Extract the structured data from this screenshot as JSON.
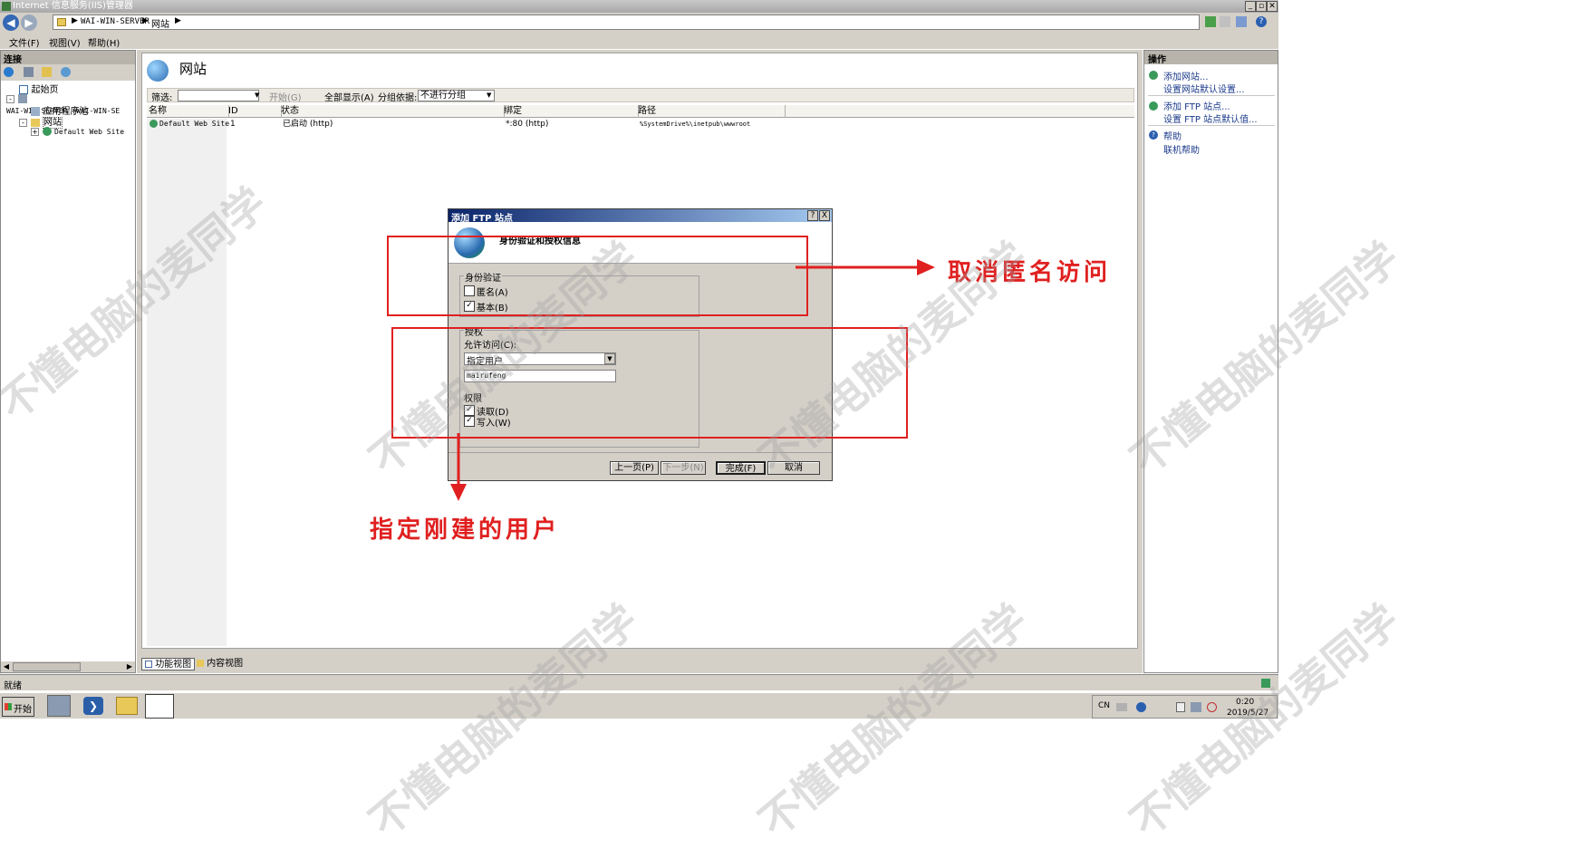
{
  "window": {
    "title": "Internet 信息服务(IIS)管理器",
    "controls": [
      "_",
      "▫",
      "✕"
    ]
  },
  "address": {
    "segments": [
      "WAI-WIN-SERVER",
      "网站"
    ]
  },
  "menu": [
    "文件(F)",
    "视图(V)",
    "帮助(H)"
  ],
  "connections": {
    "header": "连接",
    "tree": [
      {
        "label": "起始页",
        "level": 0
      },
      {
        "label": "WAI-WIN-SERVER (WAI-WIN-SE",
        "level": 0
      },
      {
        "label": "应用程序池",
        "level": 1
      },
      {
        "label": "网站",
        "level": 1
      },
      {
        "label": "Default Web Site",
        "level": 2
      }
    ]
  },
  "main": {
    "title": "网站",
    "filter_label": "筛选:",
    "start_label": "开始(G)",
    "show_all_label": "全部显示(A)",
    "group_label": "分组依据:",
    "group_value": "不进行分组",
    "columns": [
      "名称",
      "ID",
      "状态",
      "绑定",
      "路径"
    ],
    "rows": [
      {
        "name": "Default Web Site",
        "id": "1",
        "status": "已启动 (http)",
        "binding": "*:80 (http)",
        "path": "%SystemDrive%\\inetpub\\wwwroot"
      }
    ],
    "view_tabs": [
      "功能视图",
      "内容视图"
    ]
  },
  "actions": {
    "header": "操作",
    "items": [
      "添加网站...",
      "设置网站默认设置...",
      "添加 FTP 站点...",
      "设置 FTP 站点默认值...",
      "帮助",
      "联机帮助"
    ]
  },
  "dialog": {
    "title": "添加 FTP 站点",
    "help_button": "?",
    "close_button": "X",
    "heading": "身份验证和授权信息",
    "auth_group": "身份验证",
    "anonymous": {
      "label": "匿名(A)",
      "checked": false
    },
    "basic": {
      "label": "基本(B)",
      "checked": true
    },
    "authz_group": "授权",
    "allow_label": "允许访问(C):",
    "allow_value": "指定用户",
    "user_value": "mairufeng",
    "perm_label": "权限",
    "read": {
      "label": "读取(D)",
      "checked": true
    },
    "write": {
      "label": "写入(W)",
      "checked": true
    },
    "buttons": [
      "上一页(P)",
      "下一步(N)",
      "完成(F)",
      "取消"
    ]
  },
  "annotations": {
    "cancel_anonymous": "取消匿名访问",
    "specify_user": "指定刚建的用户",
    "color": "#e02020"
  },
  "status": {
    "text": "就绪"
  },
  "taskbar": {
    "start": "开始",
    "tray": {
      "lang": "CN",
      "time": "0:20",
      "date": "2019/5/27"
    }
  },
  "watermark": "不懂电脑的麦同学"
}
